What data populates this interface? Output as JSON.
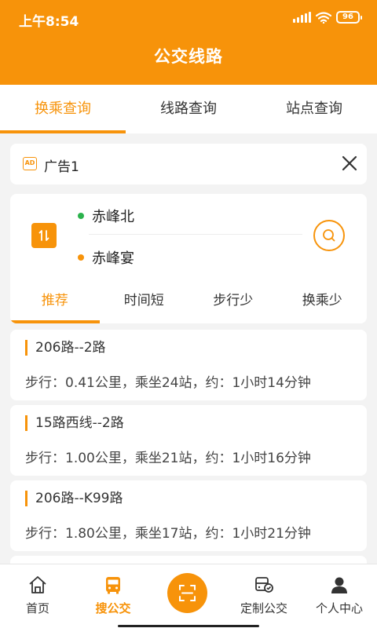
{
  "status_bar": {
    "time": "上午8:54",
    "battery": "96"
  },
  "header": {
    "title": "公交线路"
  },
  "tabs": [
    {
      "label": "换乘查询",
      "active": true
    },
    {
      "label": "线路查询",
      "active": false
    },
    {
      "label": "站点查询",
      "active": false
    }
  ],
  "ad": {
    "badge": "AD",
    "text": "广告1"
  },
  "search": {
    "from": "赤峰北",
    "to": "赤峰宴",
    "from_dot_color": "#2bb24c",
    "to_dot_color": "#f7930a"
  },
  "filters": [
    {
      "label": "推荐",
      "active": true
    },
    {
      "label": "时间短",
      "active": false
    },
    {
      "label": "步行少",
      "active": false
    },
    {
      "label": "换乘少",
      "active": false
    }
  ],
  "routes": [
    {
      "name": "206路--2路",
      "info": "步行：0.41公里，乘坐24站，约：1小时14分钟"
    },
    {
      "name": "15路西线--2路",
      "info": "步行：1.00公里，乘坐21站，约：1小时16分钟"
    },
    {
      "name": "206路--K99路",
      "info": "步行：1.80公里，乘坐17站，约：1小时21分钟"
    }
  ],
  "bottom_nav": [
    {
      "label": "首页",
      "icon": "home-icon",
      "active": false
    },
    {
      "label": "搜公交",
      "icon": "bus-icon",
      "active": true
    },
    {
      "label": "",
      "icon": "scan-icon",
      "active": false
    },
    {
      "label": "定制公交",
      "icon": "custom-bus-icon",
      "active": false
    },
    {
      "label": "个人中心",
      "icon": "user-icon",
      "active": false
    }
  ],
  "colors": {
    "accent": "#f7930a",
    "background": "#f3f3f3"
  }
}
